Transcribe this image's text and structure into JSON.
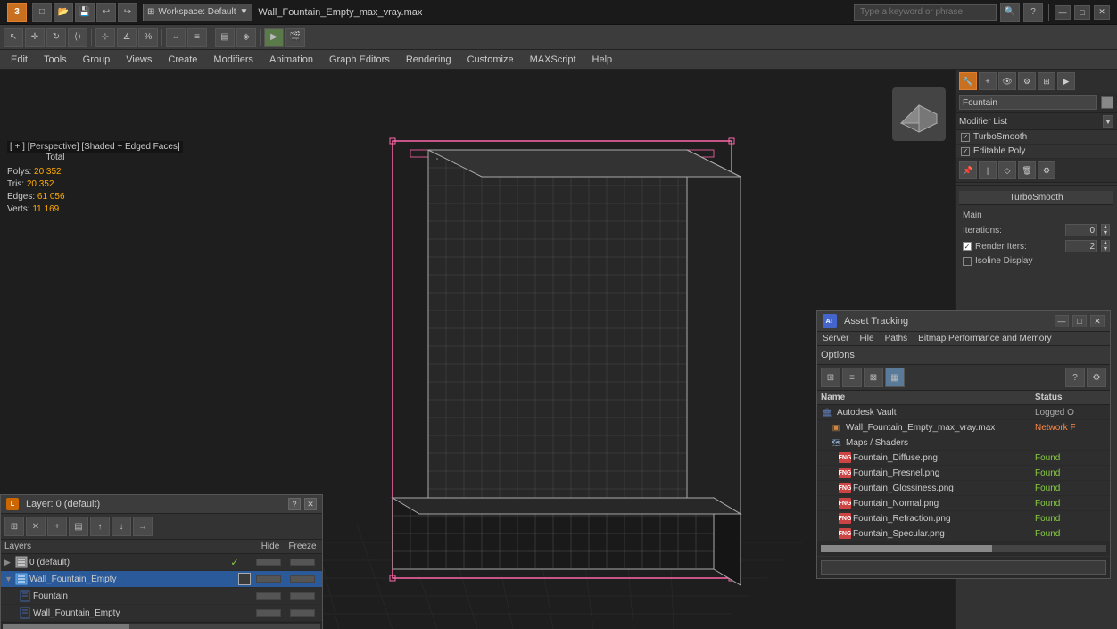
{
  "titlebar": {
    "filename": "Wall_Fountain_Empty_max_vray.max",
    "workspace_label": "Workspace: Default",
    "search_placeholder": "Type a keyword or phrase",
    "win_minimize": "—",
    "win_restore": "□",
    "win_close": "✕"
  },
  "menubar": {
    "items": [
      "Edit",
      "Tools",
      "Group",
      "Views",
      "Create",
      "Modifiers",
      "Animation",
      "Graph Editors",
      "Rendering",
      "Customize",
      "MAXScript",
      "Help"
    ]
  },
  "viewport": {
    "label": "[ + ] [Perspective] [Shaded + Edged Faces]"
  },
  "stats": {
    "polys_label": "Polys:",
    "polys_value": "20 352",
    "tris_label": "Tris:",
    "tris_value": "20 352",
    "edges_label": "Edges:",
    "edges_value": "61 056",
    "verts_label": "Verts:",
    "verts_value": "11 169",
    "total_label": "Total"
  },
  "right_panel": {
    "object_name": "Fountain",
    "modifier_list_label": "Modifier List",
    "modifiers": [
      {
        "name": "TurboSmooth",
        "checked": true
      },
      {
        "name": "Editable Poly",
        "checked": true
      }
    ],
    "turbo_smooth": {
      "title": "TurboSmooth",
      "main_label": "Main",
      "iterations_label": "Iterations:",
      "iterations_value": "0",
      "render_iters_label": "Render Iters:",
      "render_iters_value": "2",
      "isoline_display_label": "Isoline Display",
      "render_iters_checked": true
    }
  },
  "layer_panel": {
    "title": "Layer: 0 (default)",
    "help_label": "?",
    "close_label": "✕",
    "columns": {
      "layers": "Layers",
      "hide": "Hide",
      "freeze": "Freeze"
    },
    "rows": [
      {
        "name": "0 (default)",
        "indent": 0,
        "checked": true,
        "type": "layer"
      },
      {
        "name": "Wall_Fountain_Empty",
        "indent": 0,
        "selected": true,
        "type": "layer"
      },
      {
        "name": "Fountain",
        "indent": 1,
        "type": "object"
      },
      {
        "name": "Wall_Fountain_Empty",
        "indent": 1,
        "type": "object"
      }
    ]
  },
  "asset_panel": {
    "title": "Asset Tracking",
    "menus": [
      "Server",
      "File",
      "Paths",
      "Bitmap Performance and Memory",
      "Options"
    ],
    "columns": {
      "name": "Name",
      "status": "Status"
    },
    "rows": [
      {
        "name": "Autodesk Vault",
        "status": "Logged O",
        "indent": 0,
        "icon": "vault"
      },
      {
        "name": "Wall_Fountain_Empty_max_vray.max",
        "status": "Network F",
        "indent": 1,
        "icon": "max"
      },
      {
        "name": "Maps / Shaders",
        "status": "",
        "indent": 1,
        "icon": "maps"
      },
      {
        "name": "Fountain_Diffuse.png",
        "status": "Found",
        "indent": 2,
        "icon": "fng"
      },
      {
        "name": "Fountain_Fresnel.png",
        "status": "Found",
        "indent": 2,
        "icon": "fng"
      },
      {
        "name": "Fountain_Glossiness.png",
        "status": "Found",
        "indent": 2,
        "icon": "fng"
      },
      {
        "name": "Fountain_Normal.png",
        "status": "Found",
        "indent": 2,
        "icon": "fng"
      },
      {
        "name": "Fountain_Refraction.png",
        "status": "Found",
        "indent": 2,
        "icon": "fng"
      },
      {
        "name": "Fountain_Specular.png",
        "status": "Found",
        "indent": 2,
        "icon": "fng"
      }
    ]
  }
}
